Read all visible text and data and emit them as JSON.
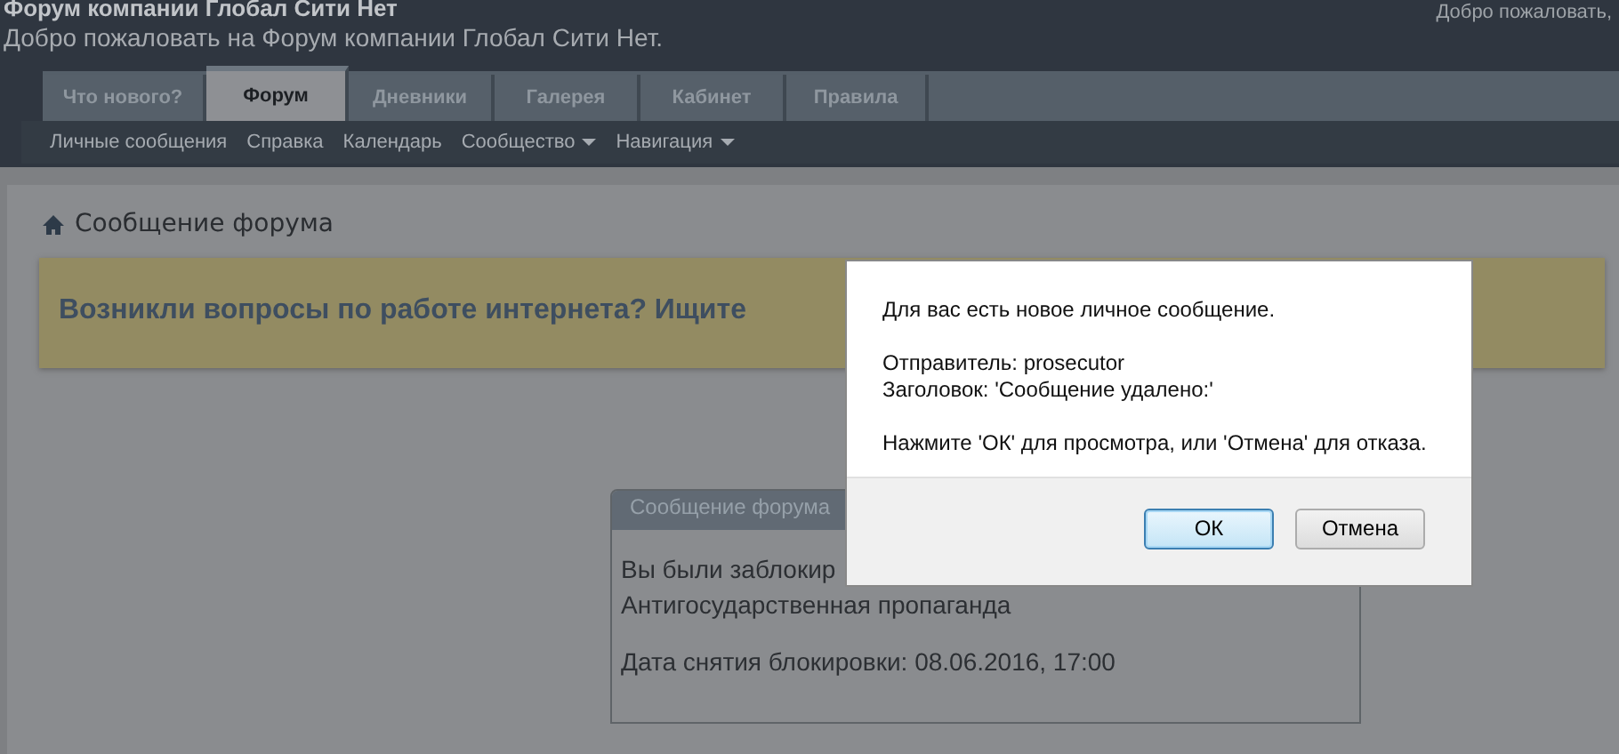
{
  "header": {
    "title": "Форум компании Глобал Сити Нет",
    "welcome": "Добро пожаловать на Форум компании Глобал Сити Нет.",
    "greeting": "Добро пожаловать,"
  },
  "tabs": [
    {
      "label": "Что нового?",
      "selected": false
    },
    {
      "label": "Форум",
      "selected": true
    },
    {
      "label": "Дневники",
      "selected": false
    },
    {
      "label": "Галерея",
      "selected": false
    },
    {
      "label": "Кабинет",
      "selected": false
    },
    {
      "label": "Правила",
      "selected": false
    }
  ],
  "subnav": [
    {
      "label": "Личные сообщения",
      "kind": "link"
    },
    {
      "label": "Справка",
      "kind": "link"
    },
    {
      "label": "Календарь",
      "kind": "link"
    },
    {
      "label": "Сообщество",
      "kind": "menu"
    },
    {
      "label": "Навигация",
      "kind": "menu"
    }
  ],
  "breadcrumb": "Сообщение форума",
  "banner": "Возникли вопросы по работе интернета? Ищите",
  "panel": {
    "title": "Сообщение форума",
    "lines": [
      "Вы были заблокир",
      "Антигосударственная пропаганда",
      "Дата снятия блокировки: 08.06.2016, 17:00"
    ]
  },
  "dialog": {
    "lines": [
      "Для вас есть новое личное сообщение.",
      "Отправитель: prosecutor",
      "Заголовок: 'Сообщение удалено:'",
      "Нажмите 'ОК' для просмотра, или 'Отмена' для отказа."
    ],
    "buttons": [
      {
        "label": "ОК",
        "default": true
      },
      {
        "label": "Отмена",
        "default": false
      }
    ]
  }
}
